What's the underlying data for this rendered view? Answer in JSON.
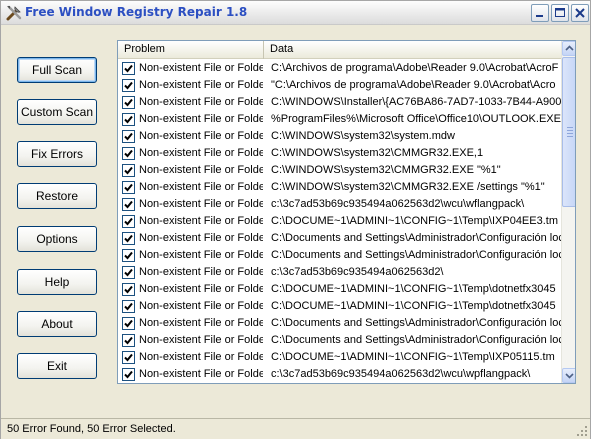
{
  "window": {
    "title": "Free Window Registry Repair 1.8",
    "app_icon": "tools-icon"
  },
  "buttons": [
    {
      "label": "Full Scan",
      "name": "full-scan-button",
      "focused": true
    },
    {
      "label": "Custom Scan",
      "name": "custom-scan-button"
    },
    {
      "label": "Fix Errors",
      "name": "fix-errors-button"
    },
    {
      "label": "Restore",
      "name": "restore-button"
    },
    {
      "label": "Options",
      "name": "options-button"
    },
    {
      "label": "Help",
      "name": "help-button"
    },
    {
      "label": "About",
      "name": "about-button"
    },
    {
      "label": "Exit",
      "name": "exit-button"
    }
  ],
  "list": {
    "columns": [
      "Problem",
      "Data"
    ],
    "rows": [
      {
        "checked": true,
        "problem": "Non-existent File or Folder",
        "data": "C:\\Archivos de programa\\Adobe\\Reader 9.0\\Acrobat\\AcroF"
      },
      {
        "checked": true,
        "problem": "Non-existent File or Folder",
        "data": "\"C:\\Archivos de programa\\Adobe\\Reader 9.0\\Acrobat\\Acro"
      },
      {
        "checked": true,
        "problem": "Non-existent File or Folder",
        "data": "C:\\WINDOWS\\Installer\\{AC76BA86-7AD7-1033-7B44-A900"
      },
      {
        "checked": true,
        "problem": "Non-existent File or Folder",
        "data": "%ProgramFiles%\\Microsoft Office\\Office10\\OUTLOOK.EXE"
      },
      {
        "checked": true,
        "problem": "Non-existent File or Folder",
        "data": "C:\\WINDOWS\\system32\\system.mdw"
      },
      {
        "checked": true,
        "problem": "Non-existent File or Folder",
        "data": "C:\\WINDOWS\\system32\\CMMGR32.EXE,1"
      },
      {
        "checked": true,
        "problem": "Non-existent File or Folder",
        "data": "C:\\WINDOWS\\system32\\CMMGR32.EXE \"%1\""
      },
      {
        "checked": true,
        "problem": "Non-existent File or Folder",
        "data": "C:\\WINDOWS\\system32\\CMMGR32.EXE /settings \"%1\""
      },
      {
        "checked": true,
        "problem": "Non-existent File or Folder",
        "data": "c:\\3c7ad53b69c935494a062563d2\\wcu\\wflangpack\\"
      },
      {
        "checked": true,
        "problem": "Non-existent File or Folder",
        "data": "C:\\DOCUME~1\\ADMINI~1\\CONFIG~1\\Temp\\IXP04EE3.tm"
      },
      {
        "checked": true,
        "problem": "Non-existent File or Folder",
        "data": "C:\\Documents and Settings\\Administrador\\Configuración loc"
      },
      {
        "checked": true,
        "problem": "Non-existent File or Folder",
        "data": "C:\\Documents and Settings\\Administrador\\Configuración loc"
      },
      {
        "checked": true,
        "problem": "Non-existent File or Folder",
        "data": "c:\\3c7ad53b69c935494a062563d2\\"
      },
      {
        "checked": true,
        "problem": "Non-existent File or Folder",
        "data": "C:\\DOCUME~1\\ADMINI~1\\CONFIG~1\\Temp\\dotnetfx3045"
      },
      {
        "checked": true,
        "problem": "Non-existent File or Folder",
        "data": "C:\\DOCUME~1\\ADMINI~1\\CONFIG~1\\Temp\\dotnetfx3045"
      },
      {
        "checked": true,
        "problem": "Non-existent File or Folder",
        "data": "C:\\Documents and Settings\\Administrador\\Configuración loc"
      },
      {
        "checked": true,
        "problem": "Non-existent File or Folder",
        "data": "C:\\Documents and Settings\\Administrador\\Configuración loc"
      },
      {
        "checked": true,
        "problem": "Non-existent File or Folder",
        "data": "C:\\DOCUME~1\\ADMINI~1\\CONFIG~1\\Temp\\IXP05115.tm"
      },
      {
        "checked": true,
        "problem": "Non-existent File or Folder",
        "data": "c:\\3c7ad53b69c935494a062563d2\\wcu\\wpflangpack\\"
      }
    ]
  },
  "status": {
    "text": "50 Error Found,  50 Error Selected."
  },
  "colors": {
    "title_text": "#2c4fc2",
    "button_border": "#003c74",
    "list_border": "#7f9db9"
  }
}
